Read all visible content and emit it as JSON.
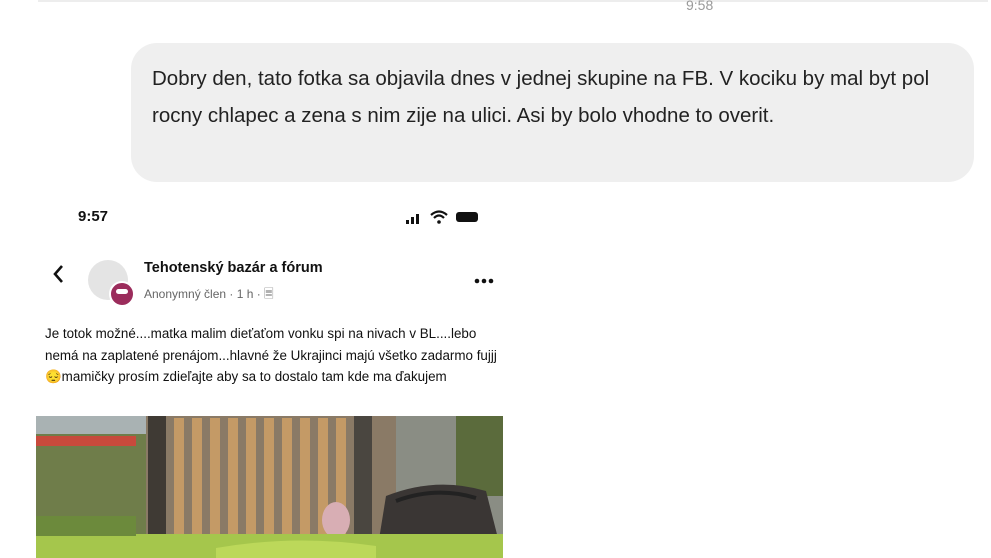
{
  "header": {
    "timestamp": "9:58"
  },
  "message": {
    "text": "Dobry den, tato fotka sa objavila dnes v jednej skupine na FB. V kociku by mal byt pol rocny chlapec a zena s nim zije na ulici. Asi by bolo vhodne to overit."
  },
  "screenshot": {
    "status_time": "9:57",
    "back_icon": "chevron-left-icon",
    "more_icon": "more-dots-icon",
    "group_name": "Tehotenský bazár a fórum",
    "meta": "Anonymný člen · 1 h · 🗏",
    "post_text": "Je totok možné....matka malim dieťaťom  vonku spi na nivach v BL....lebo nemá na zaplatené prenájom...hlavné že Ukrajinci majú všetko zadarmo  fujjj 😔mamičky prosím zdieľajte aby sa to dostalo tam kde ma ďakujem",
    "colors": {
      "badge": "#9b2c5c",
      "bench": "#b98c5a",
      "grass": "#9fc24a"
    }
  }
}
